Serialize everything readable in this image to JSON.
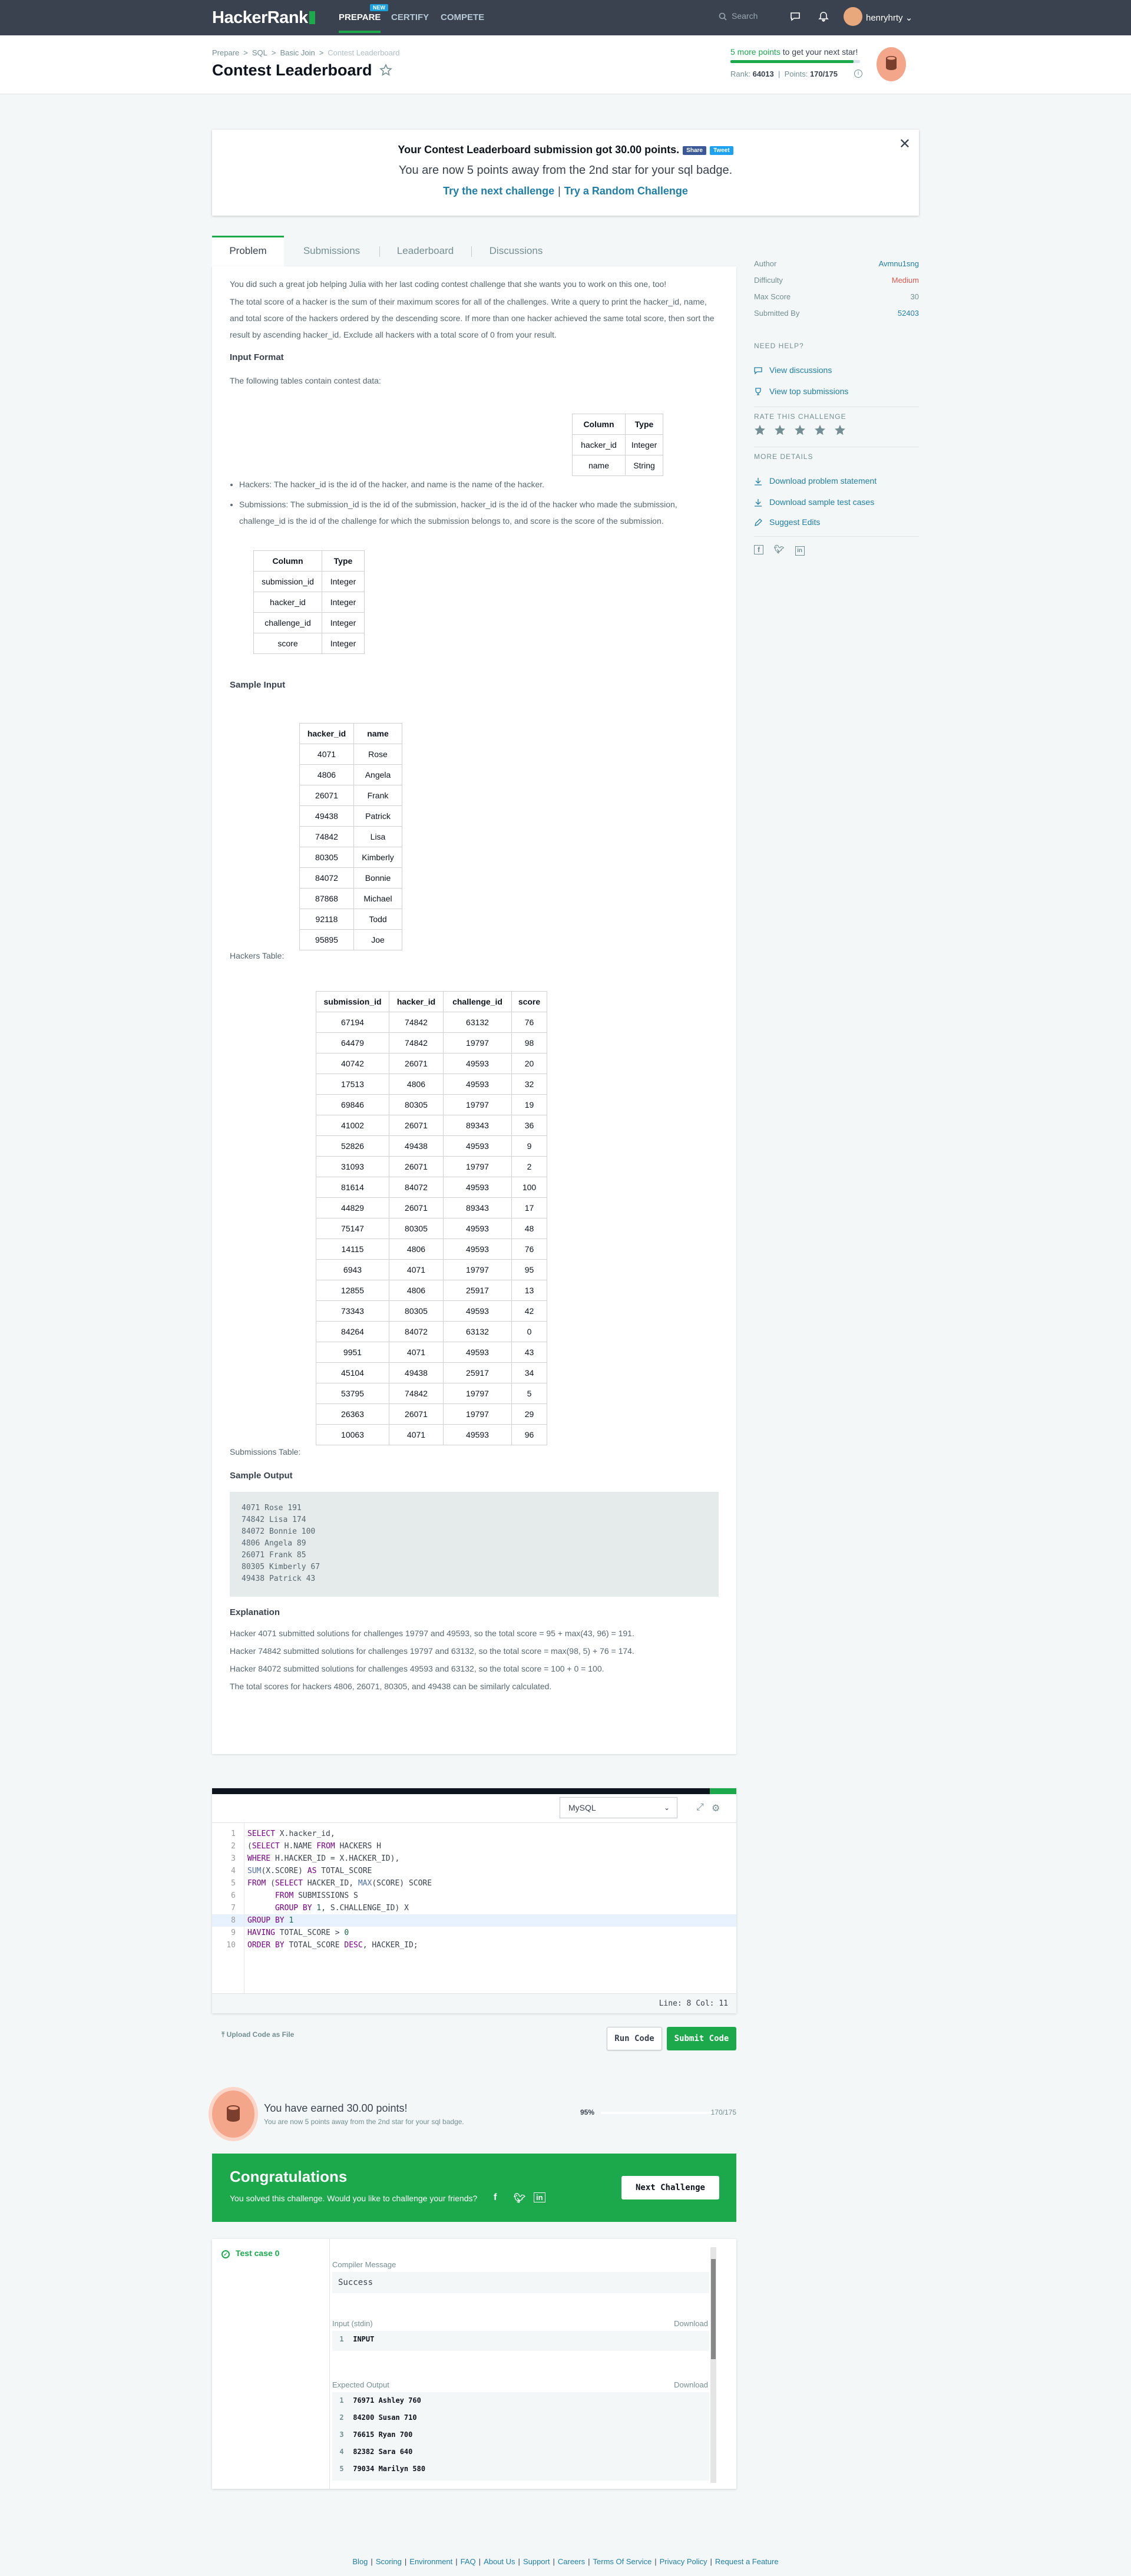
{
  "nav": {
    "logo": "HackerRank",
    "links": [
      "PREPARE",
      "CERTIFY",
      "COMPETE"
    ],
    "new_badge": "NEW",
    "search_placeholder": "Search",
    "username": "henryhrty"
  },
  "header": {
    "breadcrumb": [
      "Prepare",
      "SQL",
      "Basic Join",
      "Contest Leaderboard"
    ],
    "title": "Contest Leaderboard",
    "next_star_points": "5 more points",
    "next_star_rest": "to get your next star!",
    "star_progress_pct": 95,
    "rank_label": "Rank:",
    "rank": "64013",
    "points_label": "Points:",
    "points": "170/175"
  },
  "banner": {
    "line1": "Your Contest Leaderboard submission got 30.00 points.",
    "share": "Share",
    "tweet": "Tweet",
    "line2": "You are now 5 points away from the 2nd star for your sql badge.",
    "link1": "Try the next challenge",
    "link2": "Try a Random Challenge"
  },
  "tabs": [
    "Problem",
    "Submissions",
    "Leaderboard",
    "Discussions"
  ],
  "problem": {
    "p1": "You did such a great job helping Julia with her last coding contest challenge that she wants you to work on this one, too!",
    "p2": "The total score of a hacker is the sum of their maximum scores for all of the challenges. Write a query to print the hacker_id, name, and total score of the hackers ordered by the descending score. If more than one hacker achieved the same total score, then sort the result by ascending hacker_id. Exclude all hackers with a total score of 0 from your result.",
    "input_format": "Input Format",
    "input_intro": "The following tables contain contest data:",
    "hackers_schema": {
      "headers": [
        "Column",
        "Type"
      ],
      "rows": [
        [
          "hacker_id",
          "Integer"
        ],
        [
          "name",
          "String"
        ]
      ]
    },
    "bullet1": "Hackers: The hacker_id is the id of the hacker, and name is the name of the hacker.",
    "bullet2": "Submissions: The submission_id is the id of the submission, hacker_id is the id of the hacker who made the submission, challenge_id is the id of the challenge for which the submission belongs to, and score is the score of the submission.",
    "subs_schema": {
      "headers": [
        "Column",
        "Type"
      ],
      "rows": [
        [
          "submission_id",
          "Integer"
        ],
        [
          "hacker_id",
          "Integer"
        ],
        [
          "challenge_id",
          "Integer"
        ],
        [
          "score",
          "Integer"
        ]
      ]
    },
    "sample_input": "Sample Input",
    "hackers_sample": {
      "headers": [
        "hacker_id",
        "name"
      ],
      "rows": [
        [
          "4071",
          "Rose"
        ],
        [
          "4806",
          "Angela"
        ],
        [
          "26071",
          "Frank"
        ],
        [
          "49438",
          "Patrick"
        ],
        [
          "74842",
          "Lisa"
        ],
        [
          "80305",
          "Kimberly"
        ],
        [
          "84072",
          "Bonnie"
        ],
        [
          "87868",
          "Michael"
        ],
        [
          "92118",
          "Todd"
        ],
        [
          "95895",
          "Joe"
        ]
      ]
    },
    "hackers_caption": "Hackers Table:",
    "subs_sample": {
      "headers": [
        "submission_id",
        "hacker_id",
        "challenge_id",
        "score"
      ],
      "rows": [
        [
          "67194",
          "74842",
          "63132",
          "76"
        ],
        [
          "64479",
          "74842",
          "19797",
          "98"
        ],
        [
          "40742",
          "26071",
          "49593",
          "20"
        ],
        [
          "17513",
          "4806",
          "49593",
          "32"
        ],
        [
          "69846",
          "80305",
          "19797",
          "19"
        ],
        [
          "41002",
          "26071",
          "89343",
          "36"
        ],
        [
          "52826",
          "49438",
          "49593",
          "9"
        ],
        [
          "31093",
          "26071",
          "19797",
          "2"
        ],
        [
          "81614",
          "84072",
          "49593",
          "100"
        ],
        [
          "44829",
          "26071",
          "89343",
          "17"
        ],
        [
          "75147",
          "80305",
          "49593",
          "48"
        ],
        [
          "14115",
          "4806",
          "49593",
          "76"
        ],
        [
          "6943",
          "4071",
          "19797",
          "95"
        ],
        [
          "12855",
          "4806",
          "25917",
          "13"
        ],
        [
          "73343",
          "80305",
          "49593",
          "42"
        ],
        [
          "84264",
          "84072",
          "63132",
          "0"
        ],
        [
          "9951",
          "4071",
          "49593",
          "43"
        ],
        [
          "45104",
          "49438",
          "25917",
          "34"
        ],
        [
          "53795",
          "74842",
          "19797",
          "5"
        ],
        [
          "26363",
          "26071",
          "19797",
          "29"
        ],
        [
          "10063",
          "4071",
          "49593",
          "96"
        ]
      ]
    },
    "subs_caption": "Submissions Table:",
    "sample_output": "Sample Output",
    "output_text": "4071 Rose 191\n74842 Lisa 174\n84072 Bonnie 100\n4806 Angela 89\n26071 Frank 85\n80305 Kimberly 67\n49438 Patrick 43",
    "explanation": "Explanation",
    "e1": "Hacker 4071 submitted solutions for challenges 19797 and 49593, so the total score = 95 + max(43, 96) = 191.",
    "e2": "Hacker 74842 submitted solutions for challenges 19797 and 63132, so the total score = max(98, 5) + 76 = 174.",
    "e3": "Hacker 84072 submitted solutions for challenges 49593 and 63132, so the total score = 100 + 0 = 100.",
    "e4": "The total scores for hackers 4806, 26071, 80305, and 49438 can be similarly calculated."
  },
  "sidebar": {
    "author_label": "Author",
    "author": "Avmnu1sng",
    "difficulty_label": "Difficulty",
    "difficulty": "Medium",
    "maxscore_label": "Max Score",
    "maxscore": "30",
    "submitted_label": "Submitted By",
    "submitted": "52403",
    "need_help": "NEED HELP?",
    "view_discussions": "View discussions",
    "view_top": "View top submissions",
    "rate": "RATE THIS CHALLENGE",
    "more_details": "MORE DETAILS",
    "download_statement": "Download problem statement",
    "download_tests": "Download sample test cases",
    "suggest_edits": "Suggest Edits"
  },
  "editor": {
    "language": "MySQL",
    "status": "Line: 8 Col: 11",
    "upload": "Upload Code as File",
    "run": "Run Code",
    "submit": "Submit Code"
  },
  "earned": {
    "title": "You have earned 30.00 points!",
    "sub": "You are now 5 points away from the 2nd star for your sql badge.",
    "pct": "95%",
    "progress_pct": 95,
    "of": "170/175"
  },
  "congrats": {
    "title": "Congratulations",
    "sub": "You solved this challenge. Would you like to challenge your friends?",
    "next": "Next Challenge"
  },
  "results": {
    "testcase": "Test case 0",
    "compiler_label": "Compiler Message",
    "compiler_msg": "Success",
    "input_label": "Input (stdin)",
    "download": "Download",
    "input_val": "INPUT",
    "expected_label": "Expected Output",
    "expected": [
      "76971 Ashley 760",
      "84200 Susan 710",
      "76615 Ryan 700",
      "82382 Sara 640",
      "79034 Marilyn 580"
    ]
  },
  "footer": [
    "Blog",
    "Scoring",
    "Environment",
    "FAQ",
    "About Us",
    "Support",
    "Careers",
    "Terms Of Service",
    "Privacy Policy",
    "Request a Feature"
  ]
}
